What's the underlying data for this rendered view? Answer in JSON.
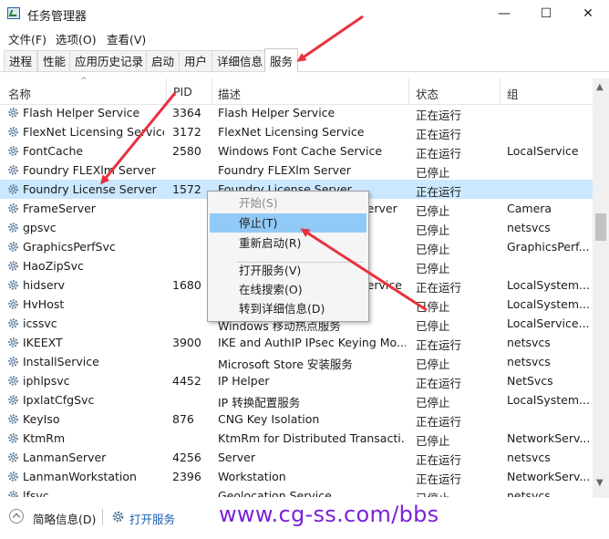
{
  "window": {
    "title": "任务管理器",
    "minimize": "—",
    "maximize": "☐",
    "close": "✕"
  },
  "menu": [
    "文件(F)",
    "选项(O)",
    "查看(V)"
  ],
  "tabs": [
    "进程",
    "性能",
    "应用历史记录",
    "启动",
    "用户",
    "详细信息",
    "服务"
  ],
  "active_tab": "服务",
  "columns": {
    "name": "名称",
    "pid": "PID",
    "desc": "描述",
    "status": "状态",
    "group": "组"
  },
  "rows": [
    {
      "name": "Flash Helper Service",
      "pid": "3364",
      "desc": "Flash Helper Service",
      "status": "正在运行",
      "group": ""
    },
    {
      "name": "FlexNet Licensing Service",
      "pid": "3172",
      "desc": "FlexNet Licensing Service",
      "status": "正在运行",
      "group": ""
    },
    {
      "name": "FontCache",
      "pid": "2580",
      "desc": "Windows Font Cache Service",
      "status": "正在运行",
      "group": "LocalService"
    },
    {
      "name": "Foundry FLEXlm Server",
      "pid": "",
      "desc": "Foundry FLEXlm Server",
      "status": "已停止",
      "group": ""
    },
    {
      "name": "Foundry License Server",
      "pid": "1572",
      "desc": "Foundry License Server",
      "status": "正在运行",
      "group": ""
    },
    {
      "name": "FrameServer",
      "pid": "",
      "desc": "Windows Camera Frame Server",
      "status": "已停止",
      "group": "Camera"
    },
    {
      "name": "gpsvc",
      "pid": "",
      "desc": "",
      "status": "已停止",
      "group": "netsvcs"
    },
    {
      "name": "GraphicsPerfSvc",
      "pid": "",
      "desc": "",
      "status": "已停止",
      "group": "GraphicsPerf..."
    },
    {
      "name": "HaoZipSvc",
      "pid": "",
      "desc": "",
      "status": "已停止",
      "group": ""
    },
    {
      "name": "hidserv",
      "pid": "1680",
      "desc": "Human Interface Device Service",
      "status": "正在运行",
      "group": "LocalSystem..."
    },
    {
      "name": "HvHost",
      "pid": "",
      "desc": "",
      "status": "已停止",
      "group": "LocalSystem..."
    },
    {
      "name": "icssvc",
      "pid": "",
      "desc": "Windows 移动热点服务",
      "status": "已停止",
      "group": "LocalService..."
    },
    {
      "name": "IKEEXT",
      "pid": "3900",
      "desc": "IKE and AuthIP IPsec Keying Mo...",
      "status": "正在运行",
      "group": "netsvcs"
    },
    {
      "name": "InstallService",
      "pid": "",
      "desc": "Microsoft Store 安装服务",
      "status": "已停止",
      "group": "netsvcs"
    },
    {
      "name": "iphlpsvc",
      "pid": "4452",
      "desc": "IP Helper",
      "status": "正在运行",
      "group": "NetSvcs"
    },
    {
      "name": "IpxlatCfgSvc",
      "pid": "",
      "desc": "IP 转换配置服务",
      "status": "已停止",
      "group": "LocalSystem..."
    },
    {
      "name": "KeyIso",
      "pid": "876",
      "desc": "CNG Key Isolation",
      "status": "正在运行",
      "group": ""
    },
    {
      "name": "KtmRm",
      "pid": "",
      "desc": "KtmRm for Distributed Transacti...",
      "status": "已停止",
      "group": "NetworkServ..."
    },
    {
      "name": "LanmanServer",
      "pid": "4256",
      "desc": "Server",
      "status": "正在运行",
      "group": "netsvcs"
    },
    {
      "name": "LanmanWorkstation",
      "pid": "2396",
      "desc": "Workstation",
      "status": "正在运行",
      "group": "NetworkServ..."
    },
    {
      "name": "lfsvc",
      "pid": "",
      "desc": "Geolocation Service",
      "status": "已停止",
      "group": "netsvcs"
    }
  ],
  "selected_row": "Foundry License Server",
  "context_menu": [
    "开始(S)",
    "停止(T)",
    "重新启动(R)",
    "打开服务(V)",
    "在线搜索(O)",
    "转到详细信息(D)"
  ],
  "footer": {
    "fewer_details": "简略信息(D)",
    "open_services": "打开服务"
  },
  "watermark": "www.cg-ss.com/bbs",
  "colors": {
    "selection": "#cce8ff",
    "menu_hover": "#91c9f7",
    "arrow": "#e8323c",
    "watermark": "#7a22d6",
    "link": "#1a5fb4"
  }
}
